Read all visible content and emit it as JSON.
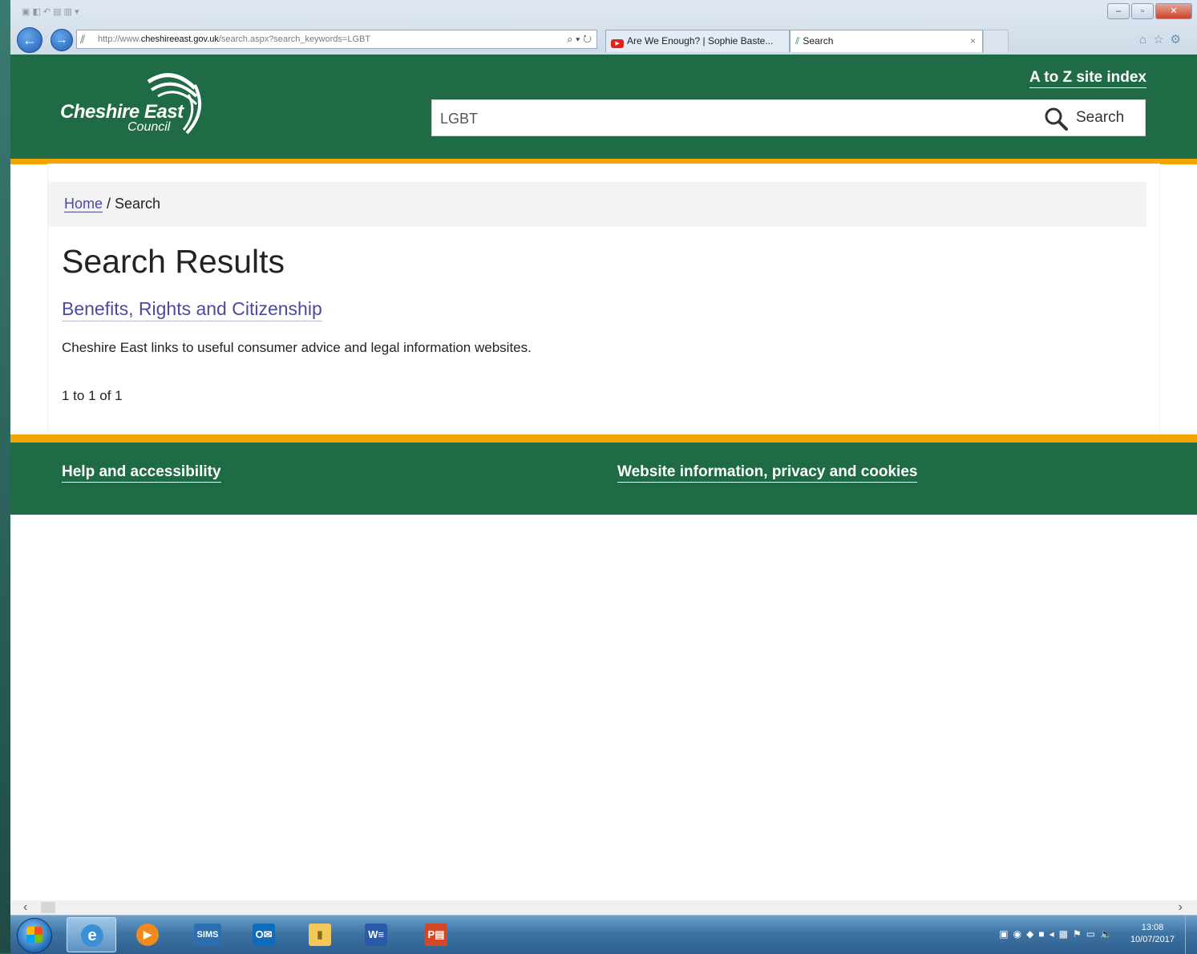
{
  "browser": {
    "url_prefix": "http://www.",
    "url_domain": "cheshireeast.gov.uk",
    "url_path": "/search.aspx?search_keywords=LGBT",
    "addr_tools": "⌕ ▾ ↻",
    "tabs": [
      {
        "label": "Are We Enough? | Sophie Baste...",
        "icon": "youtube-icon"
      },
      {
        "label": "Search",
        "icon": "cheshire-east-favicon"
      }
    ],
    "tab_close": "×"
  },
  "header": {
    "logo_name": "Cheshire East",
    "logo_sub": "Council",
    "atoz_link": "A to Z site index",
    "search_value": "LGBT",
    "search_button": "Search"
  },
  "breadcrumb": {
    "home": "Home",
    "separator": " / ",
    "current": "Search"
  },
  "main": {
    "title": "Search Results",
    "result": {
      "title": "Benefits, Rights and Citizenship",
      "description": "Cheshire East links to useful consumer advice and legal information websites."
    },
    "count": "1 to 1 of 1"
  },
  "footer": {
    "links": [
      "Help and accessibility",
      "Website information, privacy and cookies"
    ]
  },
  "taskbar": {
    "sims_label": "SIMS",
    "clock_time": "13:08",
    "clock_date": "10/07/2017"
  },
  "colors": {
    "brand_green": "#1f6b46",
    "brand_orange": "#f2a500",
    "link": "#4b4aa3"
  }
}
